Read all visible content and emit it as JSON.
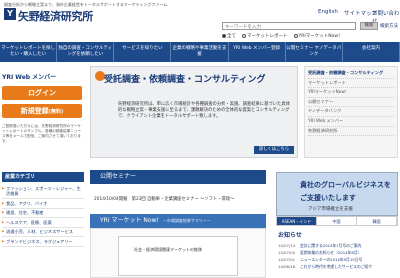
{
  "header": {
    "tagline": "調査分析から戦略立案まで、海外企業経営をトータルサポートするマーケティングファーム",
    "logo_mark": "Y",
    "logo_text": "矢野経済研究所",
    "lang_english": "English",
    "lang_sitemap": "サイトマップ",
    "lang_contact": "お問い合わせ",
    "search_placeholder": "キーワードを入力",
    "search_button": "検索",
    "advanced_search": "検索方法",
    "radio_options": [
      "全て",
      "マーケットレポート",
      "YRIマーケットNow！"
    ]
  },
  "nav": {
    "items": [
      "マーケットレポートを探したい・購入したい",
      "独自の調査・コンサルティングを依頼したい",
      "サービスを知りたい",
      "企業の戦略や事業活動を支援",
      "YRI Web メンバー登録",
      "公開セミナー ヤノデータバンク",
      "会社案内"
    ]
  },
  "sidebar": {
    "members_heading": "YRI Web メンバー",
    "login_label": "ログイン",
    "register_label": "新規登録",
    "register_suffix": "(無料)",
    "note": "ご登録頂いた方々には、矢野経済研究所のマーケットレポートのサンプル、各種の調査結果ニュース等をメールで配信、ご案内させて頂いております。",
    "category_heading": "産業カテゴリ",
    "categories": [
      "ファッション、スポーツ・レジャー、生活雑貨",
      "食品、アグリ、バイオ",
      "建設、住宅、不動産",
      "ヘルスケア、医療、医薬",
      "流通小売、人材、ビジネスサービス",
      "ブランドビジネス、ラグジュアリー"
    ]
  },
  "hero": {
    "title": "受託調査・依頼調査・コンサルティング",
    "text": "矢野経済研究所は、単に広く市場統計や各種調査の分析・実施、調査結果に基づいた具体的な戦略立案・事業支援に至るまで、課題解決のための全体的な提案とコンサルティングで、クライアント企業をトータルサポート致します。",
    "more_label": "詳しくはこちら"
  },
  "service_list": {
    "items": [
      "受託調査・依頼調査・コンサルティング",
      "マーケットレポート",
      "YRIマーケットNow！",
      "公開セミナー",
      "ヤノデータバンク",
      "YRI Web メンバー",
      "矢野経済研究所"
    ]
  },
  "seminar": {
    "heading": "公開セミナー",
    "row": "2014/10/04開催　第23回 自動車・企業講座セミナー ～ソフト・環境～"
  },
  "yri_now": {
    "heading": "YRI マーケット Now!",
    "sub": "－市場調査結果サマリー－",
    "chart_title": "社会・経済環境関連マーケットの推移"
  },
  "global_banner": {
    "line1": "貴社のグローバルビジネスを",
    "line2": "ご支援いたします",
    "caption": "アジア市場確立を支援",
    "regions": [
      "ASEAN・インド",
      "中国",
      "韓国"
    ]
  },
  "news": {
    "heading": "お知らせ",
    "items": [
      {
        "date": "14/07/14",
        "title": "会計に関する2014年7月号のご案内"
      },
      {
        "date": "14/07/04",
        "title": "夏期休業のお知らせ（2014年8月）"
      },
      {
        "date": "14/07/01",
        "title": "ニュースレターの2014年9月15日号"
      },
      {
        "date": "14/06/16",
        "title": "これから時代を考慮したサービスのご紹介"
      }
    ]
  },
  "colors": {
    "brand_navy": "#1d4a8a",
    "accent_orange": "#e87a1a"
  }
}
